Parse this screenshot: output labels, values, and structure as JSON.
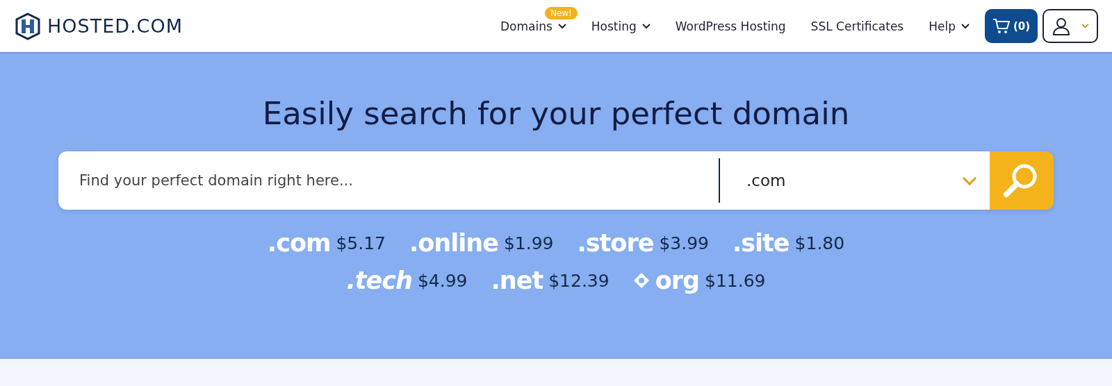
{
  "header": {
    "logo": "HOSTED.COM",
    "nav": [
      {
        "label": "Domains",
        "dropdown": true,
        "badge": "New!"
      },
      {
        "label": "Hosting",
        "dropdown": true
      },
      {
        "label": "WordPress Hosting",
        "dropdown": false
      },
      {
        "label": "SSL Certificates",
        "dropdown": false
      },
      {
        "label": "Help",
        "dropdown": true
      }
    ],
    "cart": "(0)"
  },
  "hero": {
    "title": "Easily search for your perfect domain",
    "search": {
      "placeholder": "Find your perfect domain right here...",
      "extension": ".com"
    },
    "prices": [
      [
        {
          "tld": ".com",
          "price": "$5.17",
          "kind": "plain"
        },
        {
          "tld": ".online",
          "price": "$1.99",
          "kind": "plain"
        },
        {
          "tld": ".store",
          "price": "$3.99",
          "kind": "plain"
        },
        {
          "tld": ".site",
          "price": "$1.80",
          "kind": "plain"
        }
      ],
      [
        {
          "tld": ".tech",
          "price": "$4.99",
          "kind": "italic"
        },
        {
          "tld": ".net",
          "price": "$12.39",
          "kind": "plain"
        },
        {
          "tld": "org",
          "price": "$11.69",
          "kind": "icon"
        }
      ]
    ]
  }
}
